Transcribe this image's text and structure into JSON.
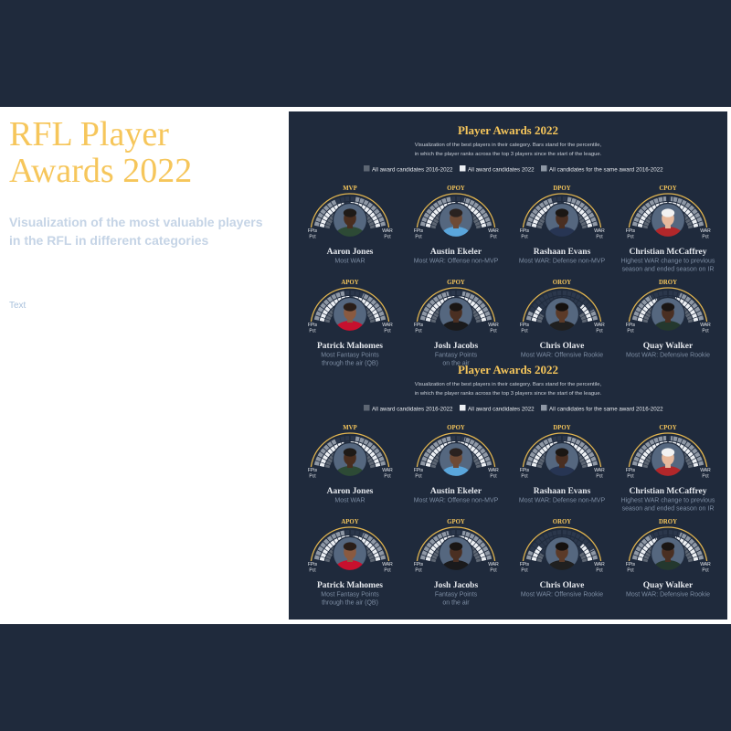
{
  "page": {
    "title_lines": [
      "RFL Player",
      "Awards 2022"
    ],
    "subtitle": "Visualization of the most valuable players in the RFL in different categories",
    "placeholder_text": "Text"
  },
  "colors": {
    "background_dark": "#1f2a3c",
    "page_white": "#ffffff",
    "accent_gold": "#f6c65b",
    "arc_gold": "#e2b54f",
    "subtitle_blue": "#c5d4e6",
    "placeholder_blue": "#a9c1dc",
    "viz_text_light": "#e6e9ee",
    "viz_subtitle": "#c9cfd8",
    "desc_gray": "#7d8da3",
    "bar_track": "#2b374b",
    "photo_background": "#55677f"
  },
  "viz": {
    "title": "Player Awards 2022",
    "subtitle_lines": [
      "Visualization of the best players in their category. Bars stand for the percentile,",
      "in which the player ranks across the top 3 players since the start of the league."
    ],
    "legend": [
      {
        "label": "All award candidates 2016-2022",
        "color": "#5d6673"
      },
      {
        "label": "All award candidates 2022",
        "color": "#eceff3"
      },
      {
        "label": "All candidates for the same award 2016-2022",
        "color": "#8f98a5"
      }
    ],
    "left_axis_label": [
      "FPts",
      "Pct"
    ],
    "right_axis_label": [
      "WAR",
      "Pct"
    ],
    "awards": [
      {
        "award": "MVP",
        "name": "Aaron Jones",
        "desc": [
          "Most WAR"
        ],
        "photo": {
          "jersey": "#2d4a35",
          "skin": "#4a2e1f",
          "hair": "#1e1a17"
        },
        "bars": {
          "fpts": [
            0.65,
            0.85,
            0.7
          ],
          "war": [
            0.92,
            1.0,
            0.88
          ]
        }
      },
      {
        "award": "OPOY",
        "name": "Austin Ekeler",
        "desc": [
          "Most WAR: Offense non-MVP"
        ],
        "photo": {
          "jersey": "#5aa6dc",
          "skin": "#6e4a35",
          "hair": "#2a2220"
        },
        "bars": {
          "fpts": [
            0.95,
            1.0,
            0.9
          ],
          "war": [
            0.88,
            0.95,
            0.82
          ]
        }
      },
      {
        "award": "DPOY",
        "name": "Rashaan Evans",
        "desc": [
          "Most WAR: Defense non-MVP"
        ],
        "photo": {
          "jersey": "#273553",
          "skin": "#4a2f22",
          "hair": "#1b1714"
        },
        "bars": {
          "fpts": [
            0.72,
            0.9,
            0.78
          ],
          "war": [
            0.85,
            0.95,
            0.88
          ]
        }
      },
      {
        "award": "CPOY",
        "name": "Christian McCaffrey",
        "desc": [
          "Highest WAR change to previous",
          "season and ended season on IR"
        ],
        "photo": {
          "jersey": "#b1272a",
          "skin": "#e7b99c",
          "hair": "#f2f2f2"
        },
        "bars": {
          "fpts": [
            0.98,
            1.0,
            0.96
          ],
          "war": [
            0.96,
            1.0,
            0.94
          ]
        }
      },
      {
        "award": "APOY",
        "name": "Patrick Mahomes",
        "desc": [
          "Most Fantasy Points",
          "through the air (QB)"
        ],
        "photo": {
          "jersey": "#c8102e",
          "skin": "#8a5a40",
          "hair": "#2a1e18"
        },
        "bars": {
          "fpts": [
            0.93,
            1.0,
            0.88
          ],
          "war": [
            0.78,
            0.92,
            0.72
          ]
        }
      },
      {
        "award": "GPOY",
        "name": "Josh Jacobs",
        "desc": [
          "Fantasy Points",
          "on the air"
        ],
        "photo": {
          "jersey": "#1a1a1c",
          "skin": "#4a2f22",
          "hair": "#1a1614"
        },
        "bars": {
          "fpts": [
            0.88,
            0.96,
            0.84
          ],
          "war": [
            0.82,
            0.92,
            0.86
          ]
        }
      },
      {
        "award": "OROY",
        "name": "Chris Olave",
        "desc": [
          "Most WAR: Offensive Rookie"
        ],
        "photo": {
          "jersey": "#202020",
          "skin": "#5b3a28",
          "hair": "#15110f"
        },
        "bars": {
          "fpts": [
            0.25,
            0.4,
            0.18
          ],
          "war": [
            0.3,
            0.45,
            0.22
          ]
        }
      },
      {
        "award": "DROY",
        "name": "Quay Walker",
        "desc": [
          "Most WAR: Defensive Rookie"
        ],
        "photo": {
          "jersey": "#24382e",
          "skin": "#4a2f22",
          "hair": "#1a1614"
        },
        "bars": {
          "fpts": [
            0.55,
            0.72,
            0.62
          ],
          "war": [
            0.68,
            0.82,
            0.74
          ]
        }
      }
    ]
  }
}
